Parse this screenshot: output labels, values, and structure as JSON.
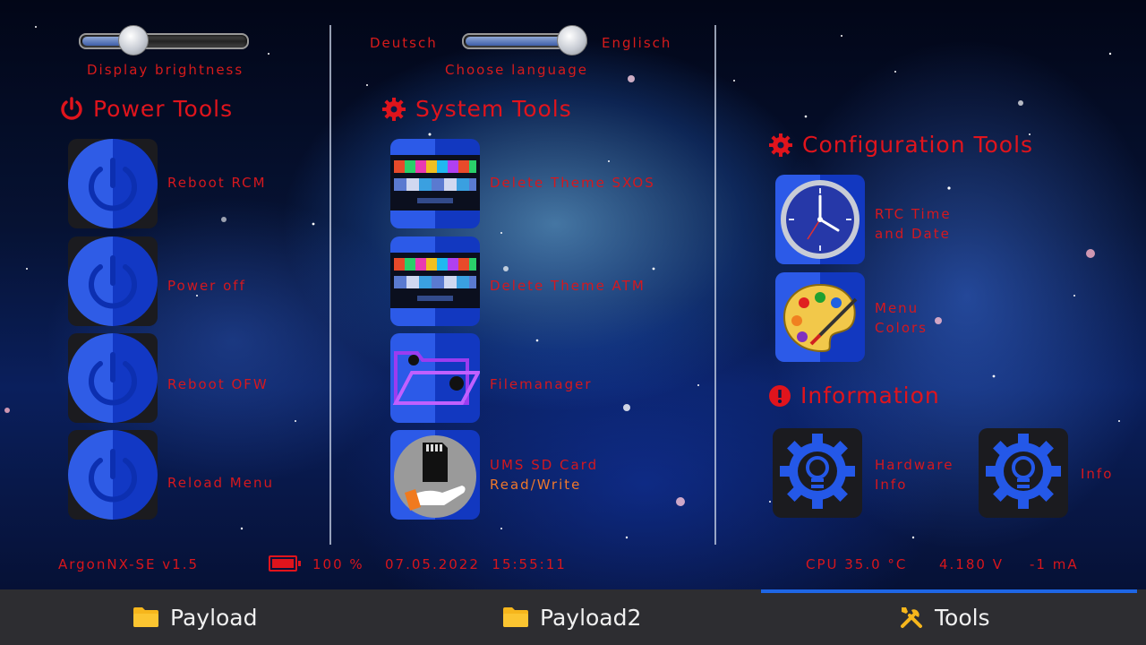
{
  "sliders": {
    "brightness": {
      "label": "Display brightness",
      "value": 0.3
    },
    "language": {
      "label": "Choose language",
      "left_option": "Deutsch",
      "right_option": "Englisch",
      "value": 0.95
    }
  },
  "sections": {
    "power": {
      "title": "Power Tools",
      "items": [
        {
          "label": "Reboot RCM"
        },
        {
          "label": "Power off"
        },
        {
          "label": "Reboot OFW"
        },
        {
          "label": "Reload Menu"
        }
      ]
    },
    "system": {
      "title": "System Tools",
      "items": [
        {
          "label": "Delete Theme SXOS"
        },
        {
          "label": "Delete Theme ATM"
        },
        {
          "label": "Filemanager"
        },
        {
          "label_line1": "UMS SD Card",
          "label_line2": "Read/Write"
        }
      ]
    },
    "configuration": {
      "title": "Configuration Tools",
      "items": [
        {
          "label_line1": "RTC Time",
          "label_line2": "and Date"
        },
        {
          "label_line1": "Menu",
          "label_line2": "Colors"
        }
      ]
    },
    "information": {
      "title": "Information",
      "items": [
        {
          "label_line1": "Hardware",
          "label_line2": "Info"
        },
        {
          "label": "Info"
        }
      ]
    }
  },
  "status": {
    "version": "ArgonNX-SE v1.5",
    "battery_percent": "100 %",
    "battery_level": 1.0,
    "datetime": "07.05.2022  15:55:11",
    "cpu": "CPU 35.0 °C",
    "voltage": "4.180 V",
    "current": "-1 mA"
  },
  "tabs": [
    {
      "label": "Payload",
      "icon": "folder-icon",
      "active": false
    },
    {
      "label": "Payload2",
      "icon": "folder-icon",
      "active": false
    },
    {
      "label": "Tools",
      "icon": "tools-icon",
      "active": true
    }
  ],
  "colors": {
    "accent_red": "#e0141c",
    "tile_blue_light": "#2c5ae8",
    "tile_blue_dark": "#1238c0",
    "tab_active_underline": "#1e66e6",
    "folder_yellow": "#f6b61c"
  }
}
